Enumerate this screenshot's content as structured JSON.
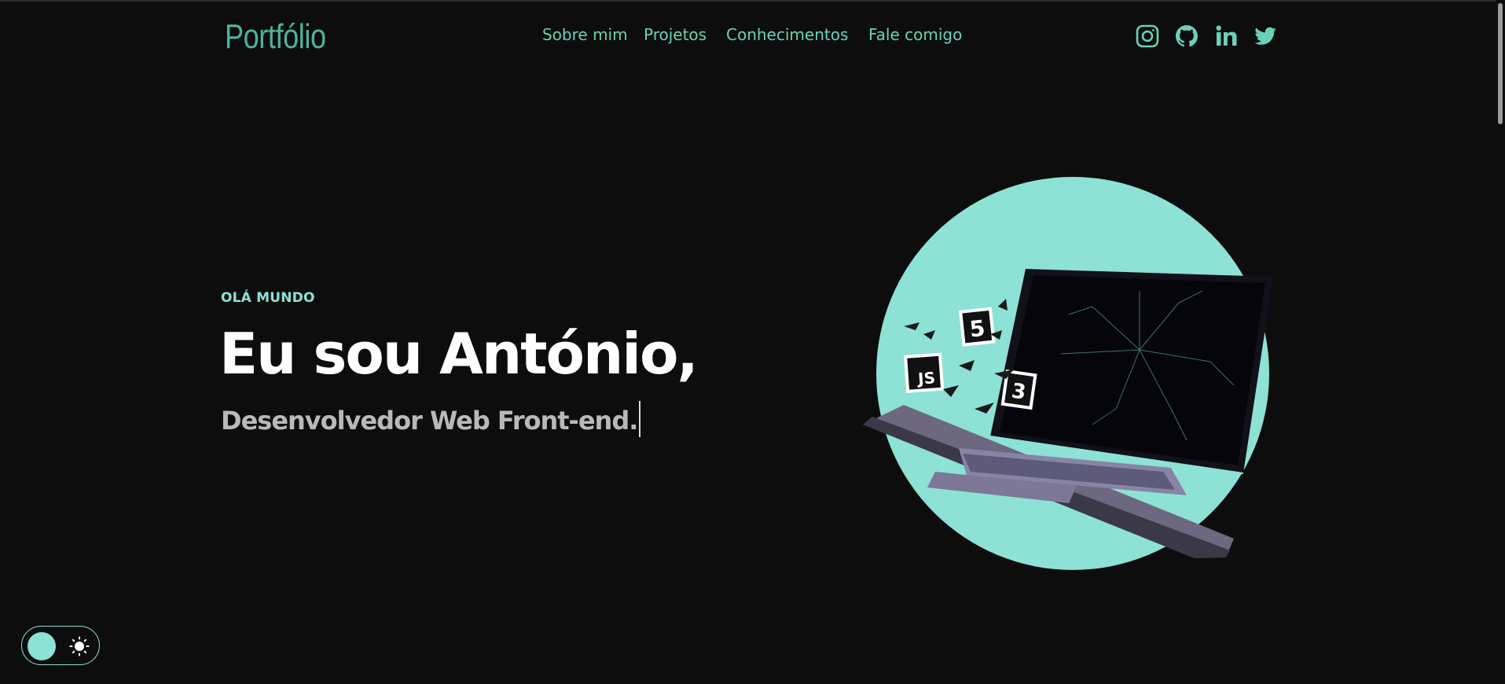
{
  "header": {
    "logo": "Portfólio",
    "nav": [
      {
        "label": "Sobre mim"
      },
      {
        "label": "Projetos"
      },
      {
        "label": "Conhecimentos"
      },
      {
        "label": "Fale comigo"
      }
    ],
    "social": [
      {
        "icon": "instagram-icon"
      },
      {
        "icon": "github-icon"
      },
      {
        "icon": "linkedin-icon"
      },
      {
        "icon": "twitter-icon"
      }
    ]
  },
  "hero": {
    "eyebrow": "OLÁ MUNDO",
    "title": "Eu sou António,",
    "subtitle": "Desenvolvedor Web Front-end.",
    "illustration": {
      "description_icon": "laptop-icon",
      "badges": [
        "5",
        "JS",
        "3"
      ]
    }
  },
  "theme_toggle": {
    "icon": "sun-icon"
  },
  "colors": {
    "background": "#0d0d0d",
    "accent": "#8de2d5",
    "nav_text": "#6ad1b8",
    "logo": "#4fb39a",
    "title": "#ffffff",
    "subtitle": "#b9b9b9"
  }
}
